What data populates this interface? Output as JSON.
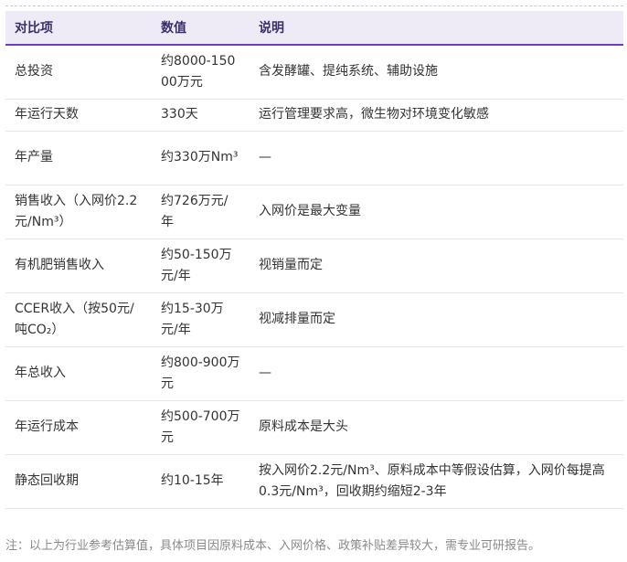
{
  "table": {
    "headers": [
      "对比项",
      "数值",
      "说明"
    ],
    "rows": [
      {
        "item": "总投资",
        "value": "约8000-15000万元",
        "note": "含发酵罐、提纯系统、辅助设施"
      },
      {
        "item": "年运行天数",
        "value": "330天",
        "note": "运行管理要求高，微生物对环境变化敏感"
      },
      {
        "item": "年产量",
        "value": "约330万Nm³",
        "note": "—"
      },
      {
        "item": "销售收入（入网价2.2元/Nm³）",
        "value": "约726万元/年",
        "note": "入网价是最大变量"
      },
      {
        "item": "有机肥销售收入",
        "value": "约50-150万元/年",
        "note": "视销量而定"
      },
      {
        "item": "CCER收入（按50元/吨CO₂）",
        "value": "约15-30万元/年",
        "note": "视减排量而定"
      },
      {
        "item": "年总收入",
        "value": "约800-900万元",
        "note": "—"
      },
      {
        "item": "年运行成本",
        "value": "约500-700万元",
        "note": "原料成本是大头"
      },
      {
        "item": "静态回收期",
        "value": "约10-15年",
        "note": "按入网价2.2元/Nm³、原料成本中等假设估算，入网价每提高0.3元/Nm³，回收期约缩短2-3年"
      }
    ]
  },
  "footnote": "注：以上为行业参考估算值，具体项目因原料成本、入网价格、政策补贴差异较大，需专业可研报告。"
}
